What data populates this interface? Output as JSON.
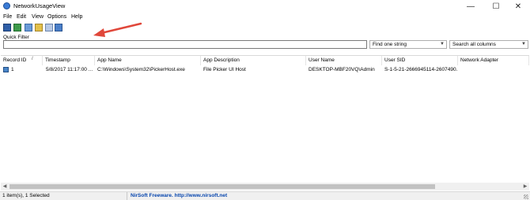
{
  "window": {
    "title": "NetworkUsageView",
    "minimize_glyph": "—",
    "maximize_glyph": "☐",
    "close_glyph": "✕"
  },
  "menu": [
    "File",
    "Edit",
    "View",
    "Options",
    "Help"
  ],
  "toolbar_icons": [
    "save-icon",
    "export-icon",
    "copy-icon",
    "properties-icon",
    "report-icon",
    "exit-icon"
  ],
  "quick_filter": {
    "label": "Quick Filter",
    "value": "",
    "mode": "Find one string",
    "scope": "Search all columns"
  },
  "columns": [
    "Record ID",
    "Timestamp",
    "App Name",
    "App Description",
    "User Name",
    "User SID",
    "Network Adapter"
  ],
  "sort_indicator": "/",
  "rows": [
    {
      "record_id": "1",
      "timestamp": "5/8/2017 11:17:00 ...",
      "app_name": "C:\\Windows\\System32\\PickerHost.exe",
      "app_description": "File Picker UI Host",
      "user_name": "DESKTOP-MBF20VQ\\Admin",
      "user_sid": "S-1-5-21-2666945114-2607490...",
      "network_adapter": ""
    }
  ],
  "status": {
    "items_text": "1 item(s), 1 Selected",
    "credit": "NirSoft Freeware.  http://www.nirsoft.net"
  },
  "colors": {
    "annotation_arrow": "#e0473a",
    "link": "#0645ad"
  }
}
